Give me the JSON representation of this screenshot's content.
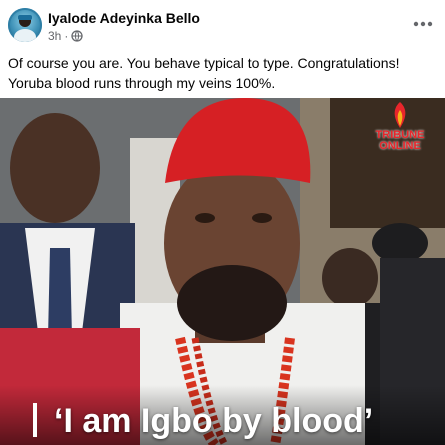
{
  "post": {
    "author": "Iyalode Adeyinka Bello",
    "time": "3h",
    "privacy_icon": "globe-icon",
    "more_icon": "more-options-icon",
    "text": "Of course you are. You behave typical to type. Congratulations! Yoruba blood runs through my veins 100%."
  },
  "media": {
    "caption": "‘I am Igbo by blood’",
    "logo_lines": [
      "TRIBUNE",
      "ONLINE"
    ],
    "cap_color": "#d62024",
    "bead_color": "#d9341f"
  }
}
